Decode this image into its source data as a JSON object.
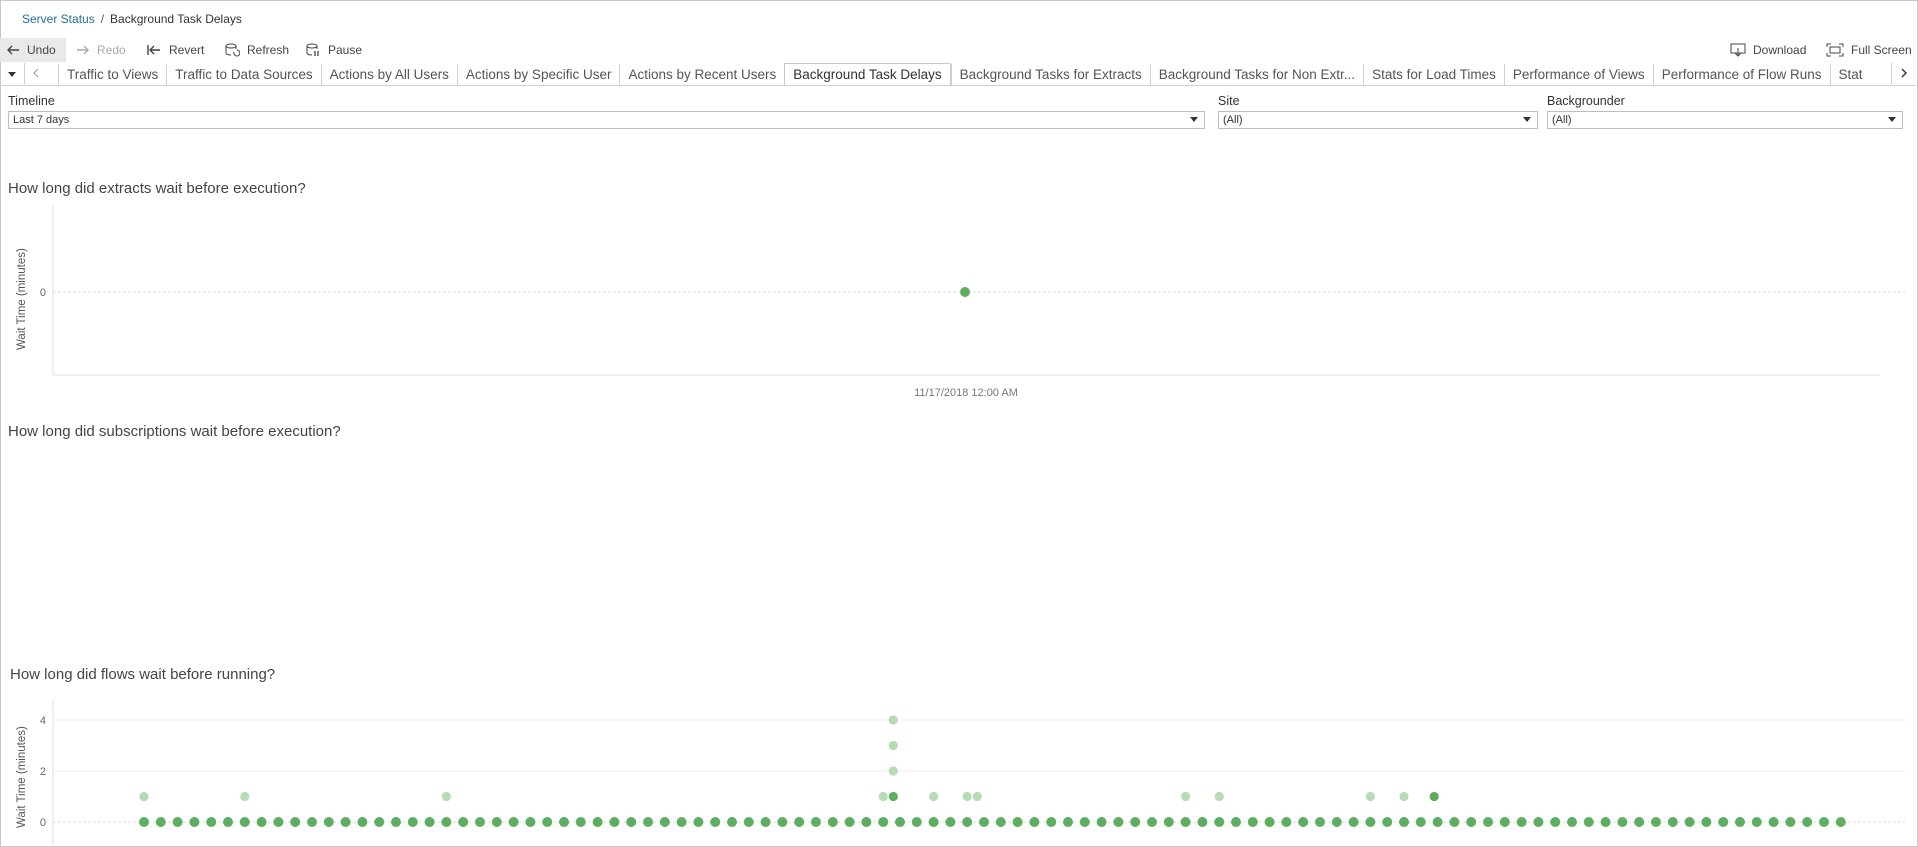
{
  "breadcrumb": {
    "parent": "Server Status",
    "separator": "/",
    "current": "Background Task Delays"
  },
  "toolbar": {
    "undo": "Undo",
    "redo": "Redo",
    "revert": "Revert",
    "refresh": "Refresh",
    "pause": "Pause",
    "download": "Download",
    "full_screen": "Full Screen"
  },
  "tabs": [
    "Traffic to Views",
    "Traffic to Data Sources",
    "Actions by All Users",
    "Actions by Specific User",
    "Actions by Recent Users",
    "Background Task Delays",
    "Background Tasks for Extracts",
    "Background Tasks for Non Extr...",
    "Stats for Load Times",
    "Performance of Views",
    "Performance of Flow Runs",
    "Stat"
  ],
  "active_tab": "Background Task Delays",
  "filters": {
    "timeline": {
      "label": "Timeline",
      "value": "Last 7 days"
    },
    "site": {
      "label": "Site",
      "value": "(All)"
    },
    "backgrounder": {
      "label": "Backgrounder",
      "value": "(All)"
    }
  },
  "colors": {
    "mark_dark": "#5fae5f",
    "mark_light": "#b7dcb4",
    "link": "#1f6e9e"
  },
  "chart_data": [
    {
      "type": "scatter",
      "title": "How long did extracts wait before execution?",
      "ylabel": "Wait Time (minutes)",
      "xlabel": "",
      "x_tick": "11/17/2018 12:00 AM",
      "y_ticks": [
        0
      ],
      "points": [
        {
          "x": 0.5,
          "y": 0
        }
      ]
    },
    {
      "type": "scatter",
      "title": "How long did subscriptions wait before execution?",
      "points": []
    },
    {
      "type": "scatter",
      "title": "How long did flows wait before running?",
      "ylabel": "Wait Time (minutes)",
      "y_ticks": [
        0,
        2,
        4
      ],
      "ylim": [
        0,
        4.4
      ],
      "zero_count": 102,
      "highlight_points": [
        {
          "i": 0,
          "y": 1,
          "shade": "light"
        },
        {
          "i": 6,
          "y": 1,
          "shade": "light"
        },
        {
          "i": 18,
          "y": 1,
          "shade": "light"
        },
        {
          "i": 44,
          "y": 1,
          "shade": "light"
        },
        {
          "i": 44.6,
          "y": 1,
          "shade": "dark"
        },
        {
          "i": 44.6,
          "y": 2,
          "shade": "light"
        },
        {
          "i": 44.6,
          "y": 3,
          "shade": "light"
        },
        {
          "i": 44.6,
          "y": 4,
          "shade": "light"
        },
        {
          "i": 47,
          "y": 1,
          "shade": "light"
        },
        {
          "i": 49,
          "y": 1,
          "shade": "light"
        },
        {
          "i": 49.6,
          "y": 1,
          "shade": "light"
        },
        {
          "i": 62,
          "y": 1,
          "shade": "light"
        },
        {
          "i": 64,
          "y": 1,
          "shade": "light"
        },
        {
          "i": 73,
          "y": 1,
          "shade": "light"
        },
        {
          "i": 75,
          "y": 1,
          "shade": "light"
        },
        {
          "i": 76.8,
          "y": 1,
          "shade": "dark"
        }
      ]
    }
  ]
}
